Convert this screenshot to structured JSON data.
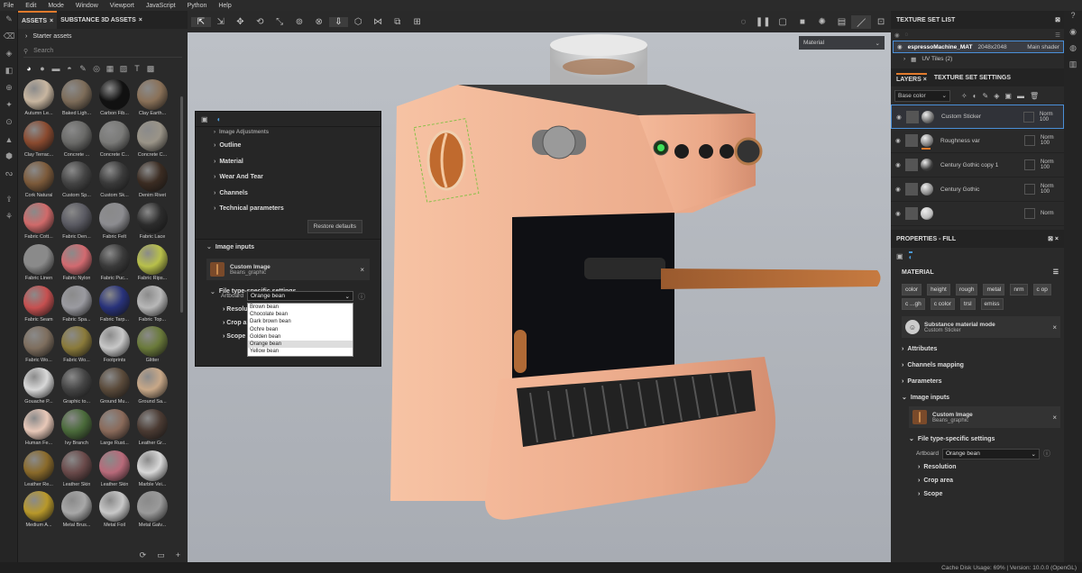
{
  "menu": [
    "File",
    "Edit",
    "Mode",
    "Window",
    "Viewport",
    "JavaScript",
    "Python",
    "Help"
  ],
  "assets": {
    "tabs": [
      "ASSETS",
      "SUBSTANCE 3D ASSETS"
    ],
    "breadcrumb": "Starter assets",
    "search_placeholder": "Search",
    "items": [
      {
        "label": "Autumn Le...",
        "color": "#c8b6a0"
      },
      {
        "label": "Baked Ligh...",
        "color": "#7d6c59"
      },
      {
        "label": "Carbon Fib...",
        "color": "#111111"
      },
      {
        "label": "Clay Earth...",
        "color": "#8a7158"
      },
      {
        "label": "Clay Terrac...",
        "color": "#8a4a2f"
      },
      {
        "label": "Concrete ...",
        "color": "#6a6a68"
      },
      {
        "label": "Concrete C...",
        "color": "#7a7a78"
      },
      {
        "label": "Concrete C...",
        "color": "#9a9488"
      },
      {
        "label": "Cork Natural",
        "color": "#7c5a3a"
      },
      {
        "label": "Custom Sp...",
        "color": "#444444"
      },
      {
        "label": "Custom Sk...",
        "color": "#3a3a3a"
      },
      {
        "label": "Denim Rivet",
        "color": "#3b2c22"
      },
      {
        "label": "Fabric Cott...",
        "color": "#d06a6a"
      },
      {
        "label": "Fabric Den...",
        "color": "#5a5a62"
      },
      {
        "label": "Fabric Felt",
        "color": "#8c8c90"
      },
      {
        "label": "Fabric Lace",
        "color": "#2c2c2c"
      },
      {
        "label": "Fabric Linen",
        "color": "#8a8a8a"
      },
      {
        "label": "Fabric Nylon",
        "color": "#d26a70"
      },
      {
        "label": "Fabric Puc...",
        "color": "#3a3a3a"
      },
      {
        "label": "Fabric Rips...",
        "color": "#b8c04a"
      },
      {
        "label": "Fabric Seam",
        "color": "#c65050"
      },
      {
        "label": "Fabric Spa...",
        "color": "#9a9aa0"
      },
      {
        "label": "Fabric Tarp...",
        "color": "#28327a"
      },
      {
        "label": "Fabric Top...",
        "color": "#b8b8b8"
      },
      {
        "label": "Fabric Wo...",
        "color": "#7e6e5e"
      },
      {
        "label": "Fabric Wo...",
        "color": "#8a7a3a"
      },
      {
        "label": "Footprints",
        "color": "#c8c8c8"
      },
      {
        "label": "Glitter",
        "color": "#6a7a3a"
      },
      {
        "label": "Gouache P...",
        "color": "#d8d8d8"
      },
      {
        "label": "Graphic to...",
        "color": "#444444"
      },
      {
        "label": "Ground Mu...",
        "color": "#5a4a3a"
      },
      {
        "label": "Ground Sa...",
        "color": "#c8a888"
      },
      {
        "label": "Human Fe...",
        "color": "#e8c8b8"
      },
      {
        "label": "Ivy Branch",
        "color": "#4a6a3a"
      },
      {
        "label": "Large Rust...",
        "color": "#8a6a5a"
      },
      {
        "label": "Leather Gr...",
        "color": "#4a3a32"
      },
      {
        "label": "Leather Re...",
        "color": "#8a6a2a"
      },
      {
        "label": "Leather Skin",
        "color": "#6a4a4a"
      },
      {
        "label": "Leather Skin",
        "color": "#b86a7a"
      },
      {
        "label": "Marble Vei...",
        "color": "#d8d8d8"
      },
      {
        "label": "Medium A...",
        "color": "#b8982a"
      },
      {
        "label": "Metal Brus...",
        "color": "#a8a8a8"
      },
      {
        "label": "Metal Foil",
        "color": "#c8c8c8"
      },
      {
        "label": "Metal Galv...",
        "color": "#9a9a9a"
      }
    ]
  },
  "viewport": {
    "material_select": "Material"
  },
  "floating_panel": {
    "sections": [
      "Image Adjustments",
      "Outline",
      "Material",
      "Wear And Tear",
      "Channels",
      "Technical parameters"
    ],
    "restore_label": "Restore defaults",
    "image_inputs_label": "Image inputs",
    "custom_image_title": "Custom Image",
    "custom_image_sub": "Beans_graphic",
    "file_type_label": "File type-specific settings",
    "artboard_label": "Artboard",
    "artboard_value": "Orange bean",
    "sub_sections": [
      "Resolution",
      "Crop area",
      "Scope"
    ],
    "options": [
      "Brown bean",
      "Chocolate bean",
      "Dark brown bean",
      "Ochre bean",
      "Golden bean",
      "Orange bean",
      "Yellow bean"
    ]
  },
  "texture_set": {
    "title": "TEXTURE SET LIST",
    "name": "espressoMachine_MAT",
    "resolution": "2048x2048",
    "shader": "Main shader",
    "uv": "UV Tiles (2)"
  },
  "layers": {
    "tabs": [
      "LAYERS",
      "TEXTURE SET SETTINGS"
    ],
    "channel": "Base color",
    "items": [
      {
        "name": "Custom Sticker",
        "blend": "Norm",
        "opacity": "100"
      },
      {
        "name": "Roughness var",
        "blend": "Norm",
        "opacity": "100"
      },
      {
        "name": "Century Gothic copy 1",
        "blend": "Norm",
        "opacity": "100"
      },
      {
        "name": "Century Gothic",
        "blend": "Norm",
        "opacity": "100"
      },
      {
        "name": "",
        "blend": "Norm",
        "opacity": ""
      }
    ]
  },
  "properties": {
    "title": "PROPERTIES - FILL",
    "material_label": "MATERIAL",
    "chips": [
      "color",
      "height",
      "rough",
      "metal",
      "nrm",
      "c op",
      "c ...gh",
      "c color",
      "trsl",
      "emiss"
    ],
    "mode_title": "Substance material mode",
    "mode_sub": "Custom Sticker",
    "sections": [
      "Attributes",
      "Channels mapping",
      "Parameters"
    ],
    "image_inputs_label": "Image inputs",
    "custom_image_title": "Custom Image",
    "custom_image_sub": "Beans_graphic",
    "file_type_label": "File type-specific settings",
    "artboard_label": "Artboard",
    "artboard_value": "Orange bean",
    "sub_sections": [
      "Resolution",
      "Crop area",
      "Scope"
    ]
  },
  "status": "Cache Disk Usage:   69%   |   Version: 10.0.0 (OpenGL)"
}
